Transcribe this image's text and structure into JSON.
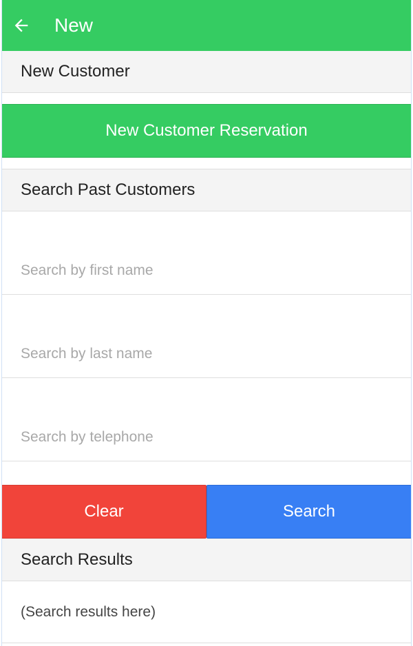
{
  "header": {
    "title": "New",
    "back_icon": "arrow-left-icon",
    "color": "#35cc62"
  },
  "new_customer": {
    "section_title": "New Customer",
    "reservation_button_label": "New Customer Reservation"
  },
  "search": {
    "section_title": "Search Past Customers",
    "first_name": {
      "value": "",
      "placeholder": "Search by first name"
    },
    "last_name": {
      "value": "",
      "placeholder": "Search by last name"
    },
    "telephone": {
      "value": "",
      "placeholder": "Search by telephone"
    },
    "clear_label": "Clear",
    "search_label": "Search",
    "clear_color": "#f1443a",
    "search_color": "#387ff4"
  },
  "results": {
    "section_title": "Search Results",
    "placeholder_text": "(Search results here)"
  }
}
